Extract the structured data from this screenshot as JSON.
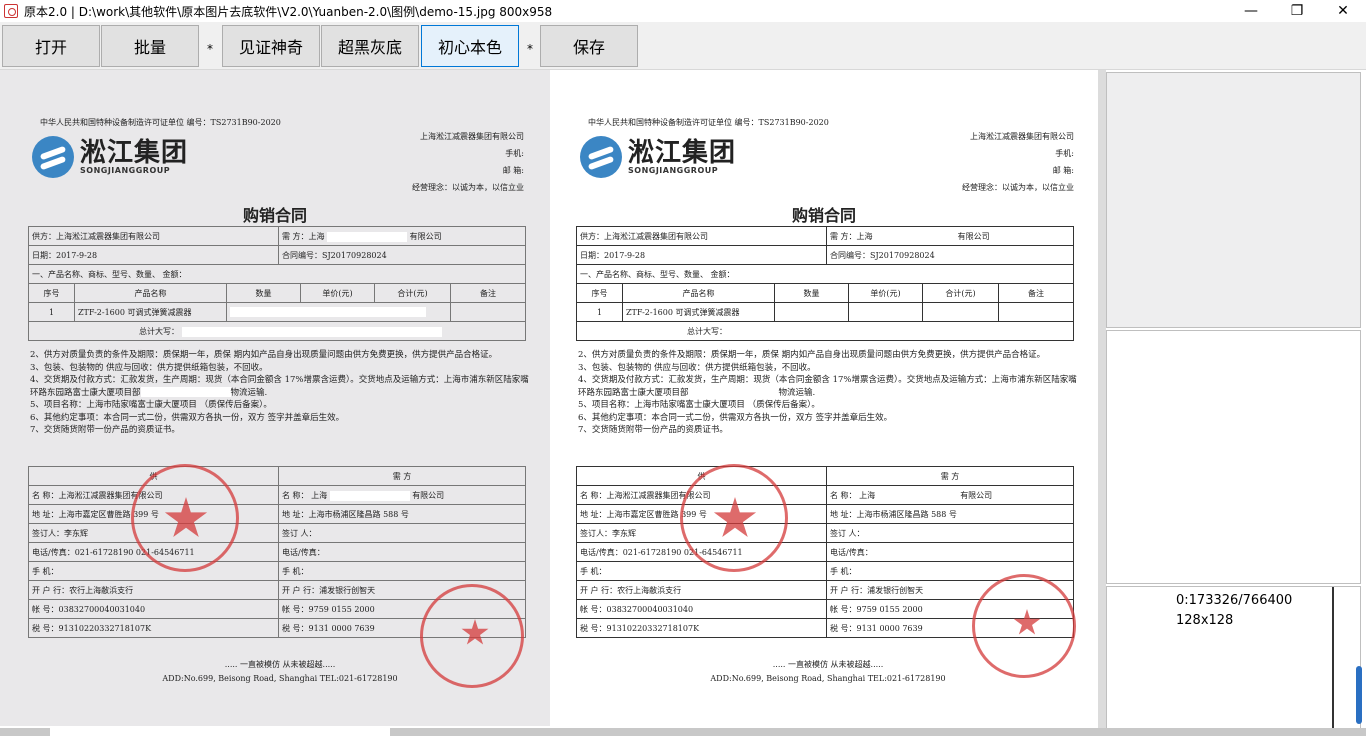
{
  "window": {
    "title": "原本2.0 | D:\\work\\其他软件\\原本图片去底软件\\V2.0\\Yuanben-2.0\\图例\\demo-15.jpg 800x958",
    "minimize": "—",
    "maximize": "❐",
    "close": "✕"
  },
  "toolbar": {
    "open": "打开",
    "batch": "批量",
    "sep1": "*",
    "witness": "见证神奇",
    "super_black": "超黑灰底",
    "original_color": "初心本色",
    "sep2": "*",
    "save": "保存"
  },
  "doc": {
    "license_line": "中华人民共和国特种设备制造许可证单位 编号：TS2731B90-2020",
    "logo_name": "淞江集团",
    "logo_sub": "SONGJIANGGROUP",
    "company_name": "上海淞江减震器集团有限公司",
    "phone_label": "手机:",
    "email_label": "邮 箱:",
    "motto": "经营理念：以诚为本，以信立业",
    "title": "购销合同",
    "supplier": "供方：上海淞江减震器集团有限公司",
    "buyer_label": "需 方：上海",
    "buyer_suffix": "有限公司",
    "date": "日期：2017-9-28",
    "contract_no": "合同编号：SJ20170928024",
    "section1": "一、产品名称、商标、型号、数量、 金额：",
    "col_no": "序号",
    "col_name": "产品名称",
    "col_qty": "数量",
    "col_price": "单价(元)",
    "col_total": "合计(元)",
    "col_note": "备注",
    "row1_no": "1",
    "row1_name": "ZTF-2-1600 可调式弹簧减震器",
    "total_label": "总计大写：",
    "term2": "2、供方对质量负责的条件及期限：质保期一年，质保 期内如产品自身出现质量问题由供方免费更换，供方提供产品合格证。",
    "term3": "3、包装、包装物的 供应与回收：供方提供纸箱包装，不回收。",
    "term4": "4、交货期及付款方式：汇款发货，生产周期：现货（本合同金额含 17%增票含运费）。交货地点及运输方式：上海市浦东新区陆家嘴环路东园路富士康大厦项目部",
    "term4_tail": "物流运输.",
    "term5": "5、项目名称：上海市陆家嘴富士康大厦项目",
    "term5_tail": "（质保传后备案）。",
    "term6": "6、其他约定事项：本合同一式二份，供需双方各执一份，双方 签字并盖章后生效。",
    "term7": "7、交货随货附带一份产品的资质证书。",
    "party_supply": "供",
    "party_demand": "需 方",
    "s_name": "名 称：上海淞江减震器集团有限公司",
    "d_name": "名 称： 上海",
    "d_name_tail": "有限公司",
    "s_addr": "地 址：上海市嘉定区曹胜路 399 号",
    "d_addr": "地 址：上海市杨浦区隆昌路 588 号",
    "s_signer": "签订人：李东辉",
    "d_signer": "签订 人：",
    "s_phone": "电话/传真：021-61728190 021-64546711",
    "d_phone": "电话/传真：",
    "s_mobile": "手 机：",
    "d_mobile": "手 机：",
    "s_bank": "开 户 行：农行上海敝浜支行",
    "d_bank": "开 户 行：浦发银行创智天",
    "s_account": "帐 号：03832700040031040",
    "d_account": "帐 号：9759 0155 2000",
    "s_tax": "税 号：91310220332718107K",
    "d_tax": "税 号：9131 0000 7639",
    "slogan": "..... 一直被模仿 从未被超越.....",
    "address": "ADD:No.699, Beisong Road, Shanghai TEL:021-61728190"
  },
  "side": {
    "pixel_info": "0:173326/766400",
    "size_info": "128x128"
  },
  "colors": {
    "accent": "#0078d7",
    "seal_red": "#d43a3a",
    "logo_blue": "#3b86c4"
  }
}
